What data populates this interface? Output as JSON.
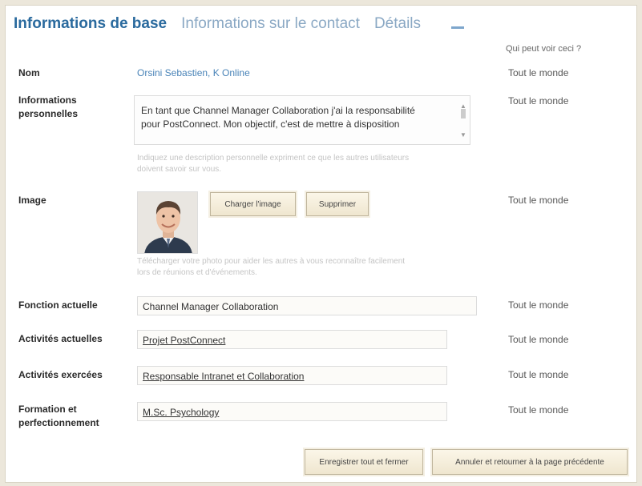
{
  "tabs": [
    {
      "label": "Informations de base",
      "active": true
    },
    {
      "label": "Informations sur le contact",
      "active": false
    },
    {
      "label": "Détails",
      "active": false
    }
  ],
  "visibility_header": "Qui peut voir ceci ?",
  "fields": {
    "nom": {
      "label": "Nom",
      "value": "Orsini Sebastien, K Online",
      "visibility": "Tout le monde"
    },
    "infos": {
      "label_line1": "Informations",
      "label_line2": "personnelles",
      "text_line1": "En tant que Channel Manager Collaboration j'ai la responsabilité",
      "text_line2": "pour PostConnect. Mon objectif, c'est de mettre à disposition",
      "hint_line1": "Indiquez une description personnelle expriment ce que les autres utilisateurs",
      "hint_line2": "doivent savoir sur vous.",
      "visibility": "Tout le monde"
    },
    "image": {
      "label": "Image",
      "upload_label": "Charger l'image",
      "delete_label": "Supprimer",
      "hint_line1": "Télécharger votre photo pour aider les autres à vous reconnaître facilement",
      "hint_line2": "lors de réunions et d'événements.",
      "visibility": "Tout le monde"
    },
    "fonction": {
      "label": "Fonction actuelle",
      "value": "Channel Manager Collaboration",
      "visibility": "Tout le monde"
    },
    "activites_actuelles": {
      "label": "Activités actuelles",
      "value": "Projet PostConnect",
      "visibility": "Tout le monde"
    },
    "activites_exercees": {
      "label": "Activités exercées",
      "value": "Responsable Intranet et Collaboration",
      "visibility": "Tout le monde"
    },
    "formation": {
      "label_line1": "Formation et",
      "label_line2": "perfectionnement",
      "value": "M.Sc. Psychology",
      "visibility": "Tout le monde"
    }
  },
  "footer": {
    "save_label": "Enregistrer tout et fermer",
    "cancel_label": "Annuler et retourner à la page précédente"
  }
}
